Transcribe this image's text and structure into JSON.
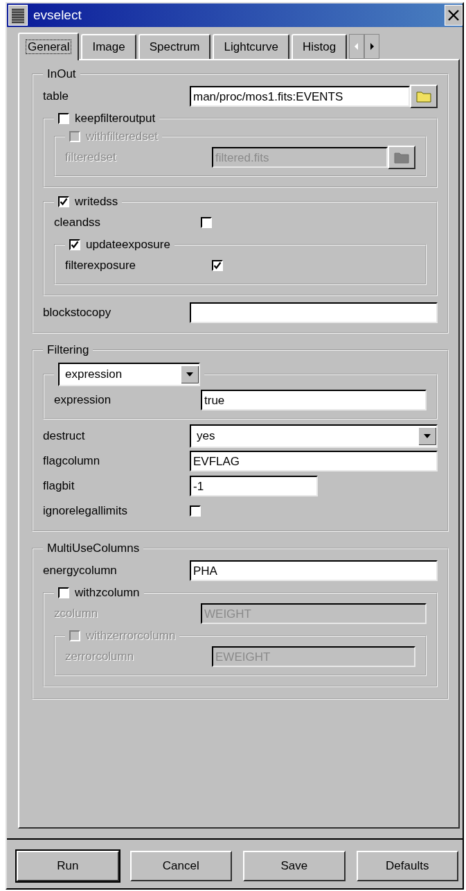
{
  "window": {
    "title": "evselect"
  },
  "tabs": [
    {
      "label": "General",
      "selected": true
    },
    {
      "label": "Image",
      "selected": false
    },
    {
      "label": "Spectrum",
      "selected": false
    },
    {
      "label": "Lightcurve",
      "selected": false
    },
    {
      "label": "Histog",
      "selected": false
    }
  ],
  "tab_scroll": {
    "left_disabled": true,
    "right_disabled": false
  },
  "sections": [
    {
      "title": "InOut",
      "items": [
        {
          "kind": "file",
          "label": "table",
          "value": "man/proc/mos1.fits:EVENTS",
          "disabled": false
        },
        {
          "kind": "group",
          "header": {
            "kind": "checkbox",
            "label": "keepfilteroutput",
            "checked": false,
            "disabled": false
          },
          "items": [
            {
              "kind": "group",
              "header": {
                "kind": "checkbox",
                "label": "withfilteredset",
                "checked": false,
                "disabled": true
              },
              "items": [
                {
                  "kind": "file",
                  "label": "filteredset",
                  "value": "filtered.fits",
                  "disabled": true
                }
              ]
            }
          ]
        },
        {
          "kind": "group",
          "header": {
            "kind": "checkbox",
            "label": "writedss",
            "checked": true,
            "disabled": false
          },
          "items": [
            {
              "kind": "check",
              "label": "cleandss",
              "checked": false,
              "disabled": false
            },
            {
              "kind": "group",
              "header": {
                "kind": "checkbox",
                "label": "updateexposure",
                "checked": true,
                "disabled": false
              },
              "items": [
                {
                  "kind": "check",
                  "label": "filterexposure",
                  "checked": true,
                  "disabled": false
                }
              ]
            }
          ]
        },
        {
          "kind": "field",
          "label": "blockstocopy",
          "disabled": false
        }
      ]
    },
    {
      "title": "Filtering",
      "items": [
        {
          "kind": "group",
          "header": {
            "kind": "dropdown",
            "value": "expression"
          },
          "items": [
            {
              "kind": "field",
              "label": "expression",
              "value": "true",
              "disabled": false
            }
          ]
        },
        {
          "kind": "select",
          "label": "destruct",
          "value": "yes",
          "disabled": false
        },
        {
          "kind": "field",
          "label": "flagcolumn",
          "value": "EVFLAG",
          "disabled": false
        },
        {
          "kind": "short-field",
          "label": "flagbit",
          "value": "-1",
          "disabled": false
        },
        {
          "kind": "check",
          "label": "ignorelegallimits",
          "checked": false,
          "disabled": false
        }
      ]
    },
    {
      "title": "MultiUseColumns",
      "items": [
        {
          "kind": "field",
          "label": "energycolumn",
          "value": "PHA",
          "disabled": false
        },
        {
          "kind": "group",
          "header": {
            "kind": "checkbox",
            "label": "withzcolumn",
            "checked": false,
            "disabled": false
          },
          "items": [
            {
              "kind": "field",
              "label": "zcolumn",
              "value": "WEIGHT",
              "disabled": true
            },
            {
              "kind": "group",
              "header": {
                "kind": "checkbox",
                "label": "withzerrorcolumn",
                "checked": false,
                "disabled": true
              },
              "items": [
                {
                  "kind": "field",
                  "label": "zerrorcolumn",
                  "value": "EWEIGHT",
                  "disabled": true
                }
              ]
            }
          ]
        }
      ]
    }
  ],
  "buttons": [
    {
      "label": "Run",
      "default": true
    },
    {
      "label": "Cancel",
      "default": false
    },
    {
      "label": "Save",
      "default": false
    },
    {
      "label": "Defaults",
      "default": false
    }
  ]
}
